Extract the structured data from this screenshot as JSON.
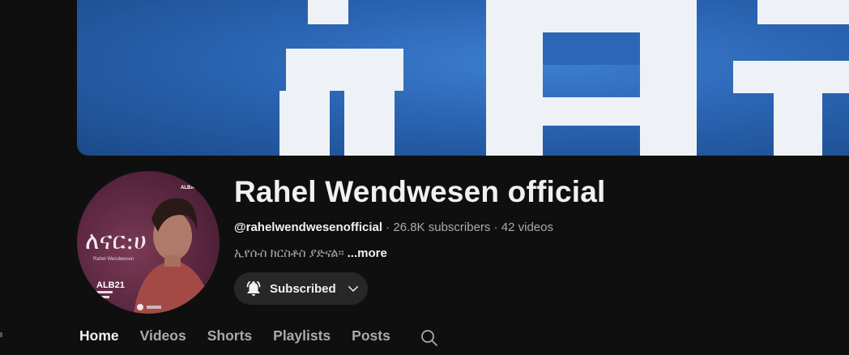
{
  "banner": {
    "text": "ኢየሱ"
  },
  "avatar": {
    "title_script": "ለናር:ሀ",
    "artist_subtitle": "Rahel Wendwesen",
    "corner_logo": "ALBA",
    "badge": "ALB21"
  },
  "channel": {
    "name": "Rahel Wendwesen official",
    "handle": "@rahelwendwesenofficial",
    "subscribers": "26.8K subscribers",
    "videos": "42 videos",
    "separator": " · ",
    "description": "ኢየሱስ ክርስቶስ ያድናል።",
    "more_label": "...more"
  },
  "subscribe": {
    "label": "Subscribed"
  },
  "tabs": [
    {
      "label": "Home",
      "active": true
    },
    {
      "label": "Videos",
      "active": false
    },
    {
      "label": "Shorts",
      "active": false
    },
    {
      "label": "Playlists",
      "active": false
    },
    {
      "label": "Posts",
      "active": false
    }
  ],
  "icons": {
    "bell": "bell-ringing-icon",
    "chevron": "chevron-down-icon",
    "search": "search-icon"
  },
  "colors": {
    "background": "#0f0f0f",
    "text_primary": "#f1f1f1",
    "text_secondary": "#aaaaaa",
    "button_bg": "#272727",
    "banner_blue": "#2a64b2"
  }
}
